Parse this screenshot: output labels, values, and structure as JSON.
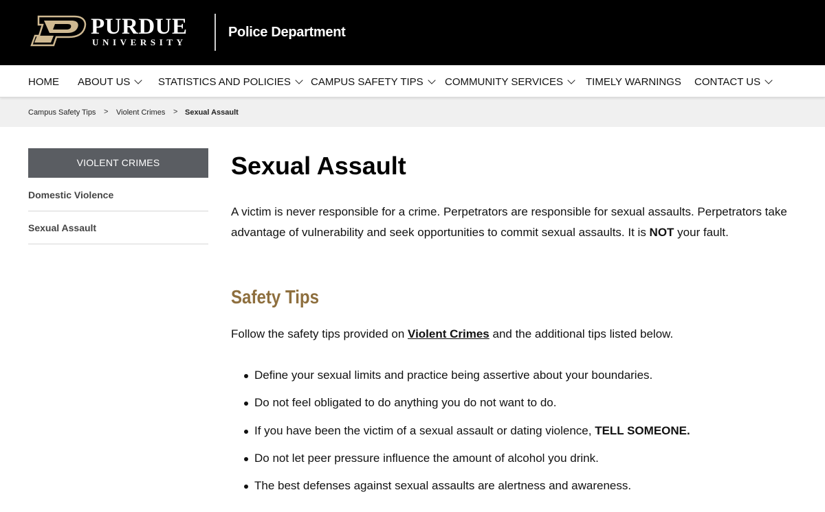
{
  "header": {
    "logo_word": "PURDUE",
    "logo_sub": "UNIVERSITY",
    "department": "Police Department",
    "brand_gold": "#cfb991",
    "background": "#000000"
  },
  "nav": {
    "items": [
      {
        "label": "HOME",
        "dropdown": false
      },
      {
        "label": "ABOUT US",
        "dropdown": true
      },
      {
        "label": "STATISTICS AND POLICIES",
        "dropdown": true
      },
      {
        "label": "CAMPUS SAFETY TIPS",
        "dropdown": true
      },
      {
        "label": "COMMUNITY SERVICES",
        "dropdown": true
      },
      {
        "label": "TIMELY WARNINGS",
        "dropdown": false
      },
      {
        "label": "CONTACT US",
        "dropdown": true
      }
    ]
  },
  "breadcrumb": {
    "items": [
      "Campus Safety Tips",
      "Violent Crimes",
      "Sexual Assault"
    ],
    "separator": ">"
  },
  "sidebar": {
    "header": "VIOLENT CRIMES",
    "links": [
      "Domestic Violence",
      "Sexual Assault"
    ]
  },
  "content": {
    "title": "Sexual Assault",
    "intro": "A victim is never responsible for a crime. Perpetrators are responsible for sexual assaults. Perpetrators take advantage of vulnerability and seek opportunities to commit sexual assaults. It is ",
    "intro_bold": "NOT",
    "intro_end": " your fault.",
    "section_heading": "Safety Tips",
    "section_color": "#8e6f3e",
    "follow_before": "Follow the safety tips provided on ",
    "follow_link": "Violent Crimes",
    "follow_after": " and the additional tips listed below.",
    "tips": [
      {
        "text": "Define your sexual limits and practice being assertive about your boundaries.",
        "bold": ""
      },
      {
        "text": "Do not feel obligated to do anything you do not want to do.",
        "bold": ""
      },
      {
        "text": "If you have been the victim of a sexual assault or dating violence, ",
        "bold": "TELL SOMEONE."
      },
      {
        "text": "Do not let peer pressure influence the amount of alcohol you drink.",
        "bold": ""
      },
      {
        "text": "The best defenses against sexual assaults are alertness and awareness.",
        "bold": ""
      }
    ]
  }
}
